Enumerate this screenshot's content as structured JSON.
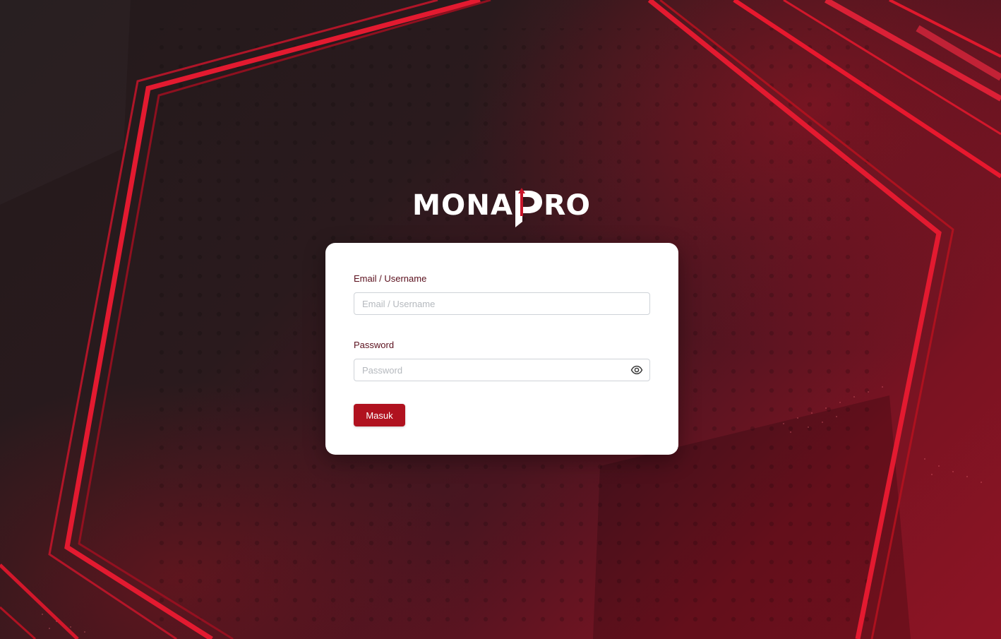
{
  "brand": {
    "logo_text": "MONAPRO"
  },
  "login_form": {
    "email_label": "Email / Username",
    "email_placeholder": "Email / Username",
    "email_value": "",
    "password_label": "Password",
    "password_placeholder": "Password",
    "password_value": "",
    "submit_label": "Masuk"
  },
  "icons": {
    "password_toggle": "eye-icon"
  },
  "colors": {
    "accent": "#b0121f",
    "label_text": "#5a0f1c",
    "background_dark": "#231a1c",
    "background_red": "#8e1424"
  }
}
